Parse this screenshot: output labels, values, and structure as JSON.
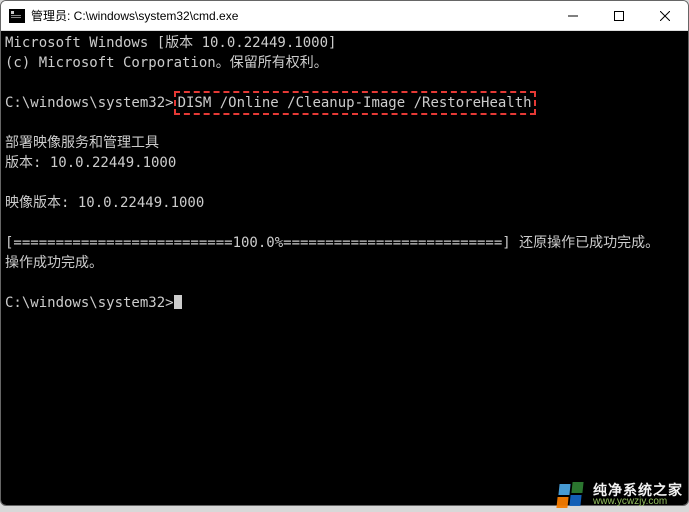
{
  "window": {
    "title": "管理员: C:\\windows\\system32\\cmd.exe"
  },
  "terminal": {
    "line1": "Microsoft Windows [版本 10.0.22449.1000]",
    "line2": "(c) Microsoft Corporation。保留所有权利。",
    "prompt1_path": "C:\\windows\\system32>",
    "prompt1_cmd": "DISM /Online /Cleanup-Image /RestoreHealth",
    "tool1": "部署映像服务和管理工具",
    "tool2": "版本: 10.0.22449.1000",
    "image_ver": "映像版本: 10.0.22449.1000",
    "progress": "[==========================100.0%==========================] 还原操作已成功完成。",
    "done": "操作成功完成。",
    "prompt2_path": "C:\\windows\\system32>"
  },
  "watermark": {
    "cn": "纯净系统之家",
    "url": "www.ycwzjy.com"
  }
}
